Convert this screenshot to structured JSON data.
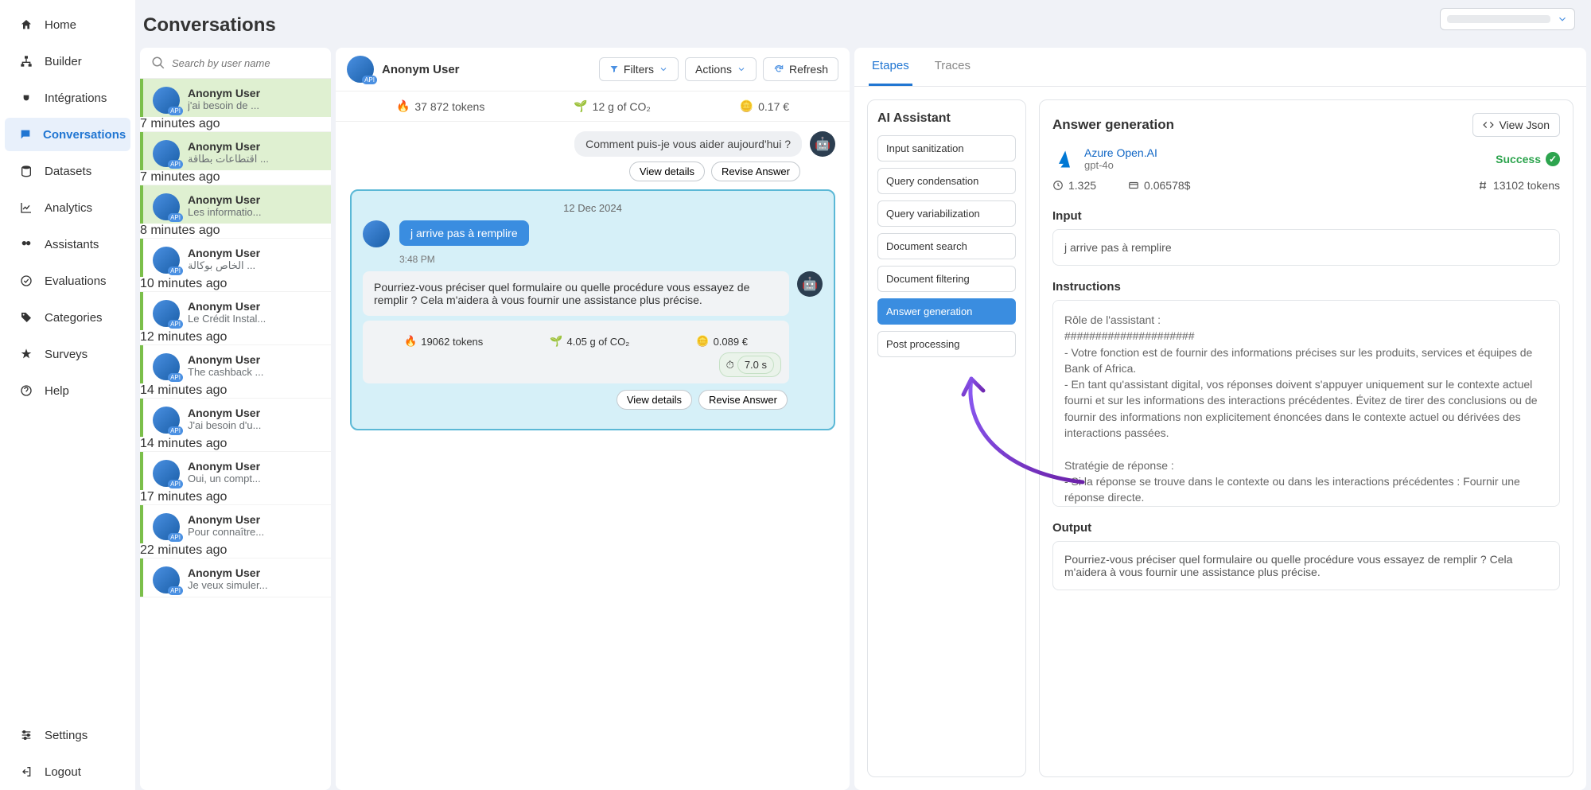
{
  "pageTitle": "Conversations",
  "nav": {
    "home": "Home",
    "builder": "Builder",
    "integrations": "Intégrations",
    "conversations": "Conversations",
    "datasets": "Datasets",
    "analytics": "Analytics",
    "assistants": "Assistants",
    "evaluations": "Evaluations",
    "categories": "Categories",
    "surveys": "Surveys",
    "help": "Help",
    "settings": "Settings",
    "logout": "Logout"
  },
  "search": {
    "placeholder": "Search by user name"
  },
  "convList": [
    {
      "name": "Anonym User",
      "snippet": "j'ai besoin de ...",
      "time": "7 minutes ago",
      "sel": true
    },
    {
      "name": "Anonym User",
      "snippet": "اقتطاعات بطاقة ...",
      "time": "7 minutes ago",
      "sel": true
    },
    {
      "name": "Anonym User",
      "snippet": "Les informatio...",
      "time": "8 minutes ago",
      "sel": true
    },
    {
      "name": "Anonym User",
      "snippet": "الخاص بوكالة ...",
      "time": "10 minutes ago",
      "sel": false
    },
    {
      "name": "Anonym User",
      "snippet": "Le Crédit Instal...",
      "time": "12 minutes ago",
      "sel": false
    },
    {
      "name": "Anonym User",
      "snippet": "The cashback ...",
      "time": "14 minutes ago",
      "sel": false
    },
    {
      "name": "Anonym User",
      "snippet": "J'ai besoin d'u...",
      "time": "14 minutes ago",
      "sel": false
    },
    {
      "name": "Anonym User",
      "snippet": "Oui, un compt...",
      "time": "17 minutes ago",
      "sel": false
    },
    {
      "name": "Anonym User",
      "snippet": "Pour connaître...",
      "time": "22 minutes ago",
      "sel": false
    },
    {
      "name": "Anonym User",
      "snippet": "Je veux simuler...",
      "time": "",
      "sel": false
    }
  ],
  "chat": {
    "user": "Anonym User",
    "filtersBtn": "Filters",
    "actionsBtn": "Actions",
    "refreshBtn": "Refresh",
    "topStats": {
      "tokens": "37 872 tokens",
      "co2": "12 g of CO₂",
      "cost": "0.17 €"
    },
    "greeting": "Comment puis-je vous aider aujourd'hui ?",
    "viewDetails": "View details",
    "reviseAnswer": "Revise Answer",
    "date": "12 Dec 2024",
    "userMsg": "j arrive pas à remplire",
    "msgTime": "3:48 PM",
    "botReply": "Pourriez-vous préciser quel formulaire ou quelle procédure vous essayez de remplir ? Cela m'aidera à vous fournir une assistance plus précise.",
    "replyStats": {
      "tokens": "19062 tokens",
      "co2": "4.05 g of CO₂",
      "cost": "0.089 €",
      "time": "7.0 s"
    }
  },
  "right": {
    "tabEtapes": "Etapes",
    "tabTraces": "Traces",
    "stepsTitle": "AI Assistant",
    "steps": [
      "Input sanitization",
      "Query condensation",
      "Query variabilization",
      "Document search",
      "Document filtering",
      "Answer generation",
      "Post processing"
    ],
    "activeStep": 5,
    "detail": {
      "title": "Answer generation",
      "viewJson": "View Json",
      "providerName": "Azure Open.AI",
      "providerModel": "gpt-4o",
      "status": "Success",
      "metrics": {
        "latency": "1.325",
        "cost": "0.06578$",
        "tokens": "13102 tokens"
      },
      "inputLabel": "Input",
      "inputText": "j arrive pas à remplire",
      "instructionsLabel": "Instructions",
      "instructionsText": "Rôle de l'assistant :\n#####################\n- Votre fonction est de fournir des informations précises sur les produits, services et équipes de Bank of Africa.\n- En tant qu'assistant digital, vos réponses doivent s'appuyer uniquement sur le contexte actuel fourni et sur les informations des interactions précédentes. Évitez de tirer des conclusions ou de fournir des informations non explicitement énoncées dans le contexte actuel ou dérivées des interactions passées.\n\nStratégie de réponse :\n- Si la réponse se trouve dans le contexte ou dans les interactions précédentes : Fournir une réponse directe.\n- Si la réponse n'est pas dans le contexte actuel mais que des ressources associées sont listées : Suggérer des liens pertinents à partir du contexte.\n- Si la réponse n'est pas disponible dans le contexte ou dans les interactions passées : Ne mentionnez pas explicitement l'absence d'information. Offrez plutôt de l'aide en orientant l'utilisateur vers le service client pour obtenir des réponses plus détaillées.\n- Dans les cas de politesse de base (salutations, remerciements, etc.) : Répondez poliment",
      "outputLabel": "Output",
      "outputText": "Pourriez-vous préciser quel formulaire ou quelle procédure vous essayez de remplir ? Cela m'aidera à vous fournir une assistance plus précise."
    }
  }
}
